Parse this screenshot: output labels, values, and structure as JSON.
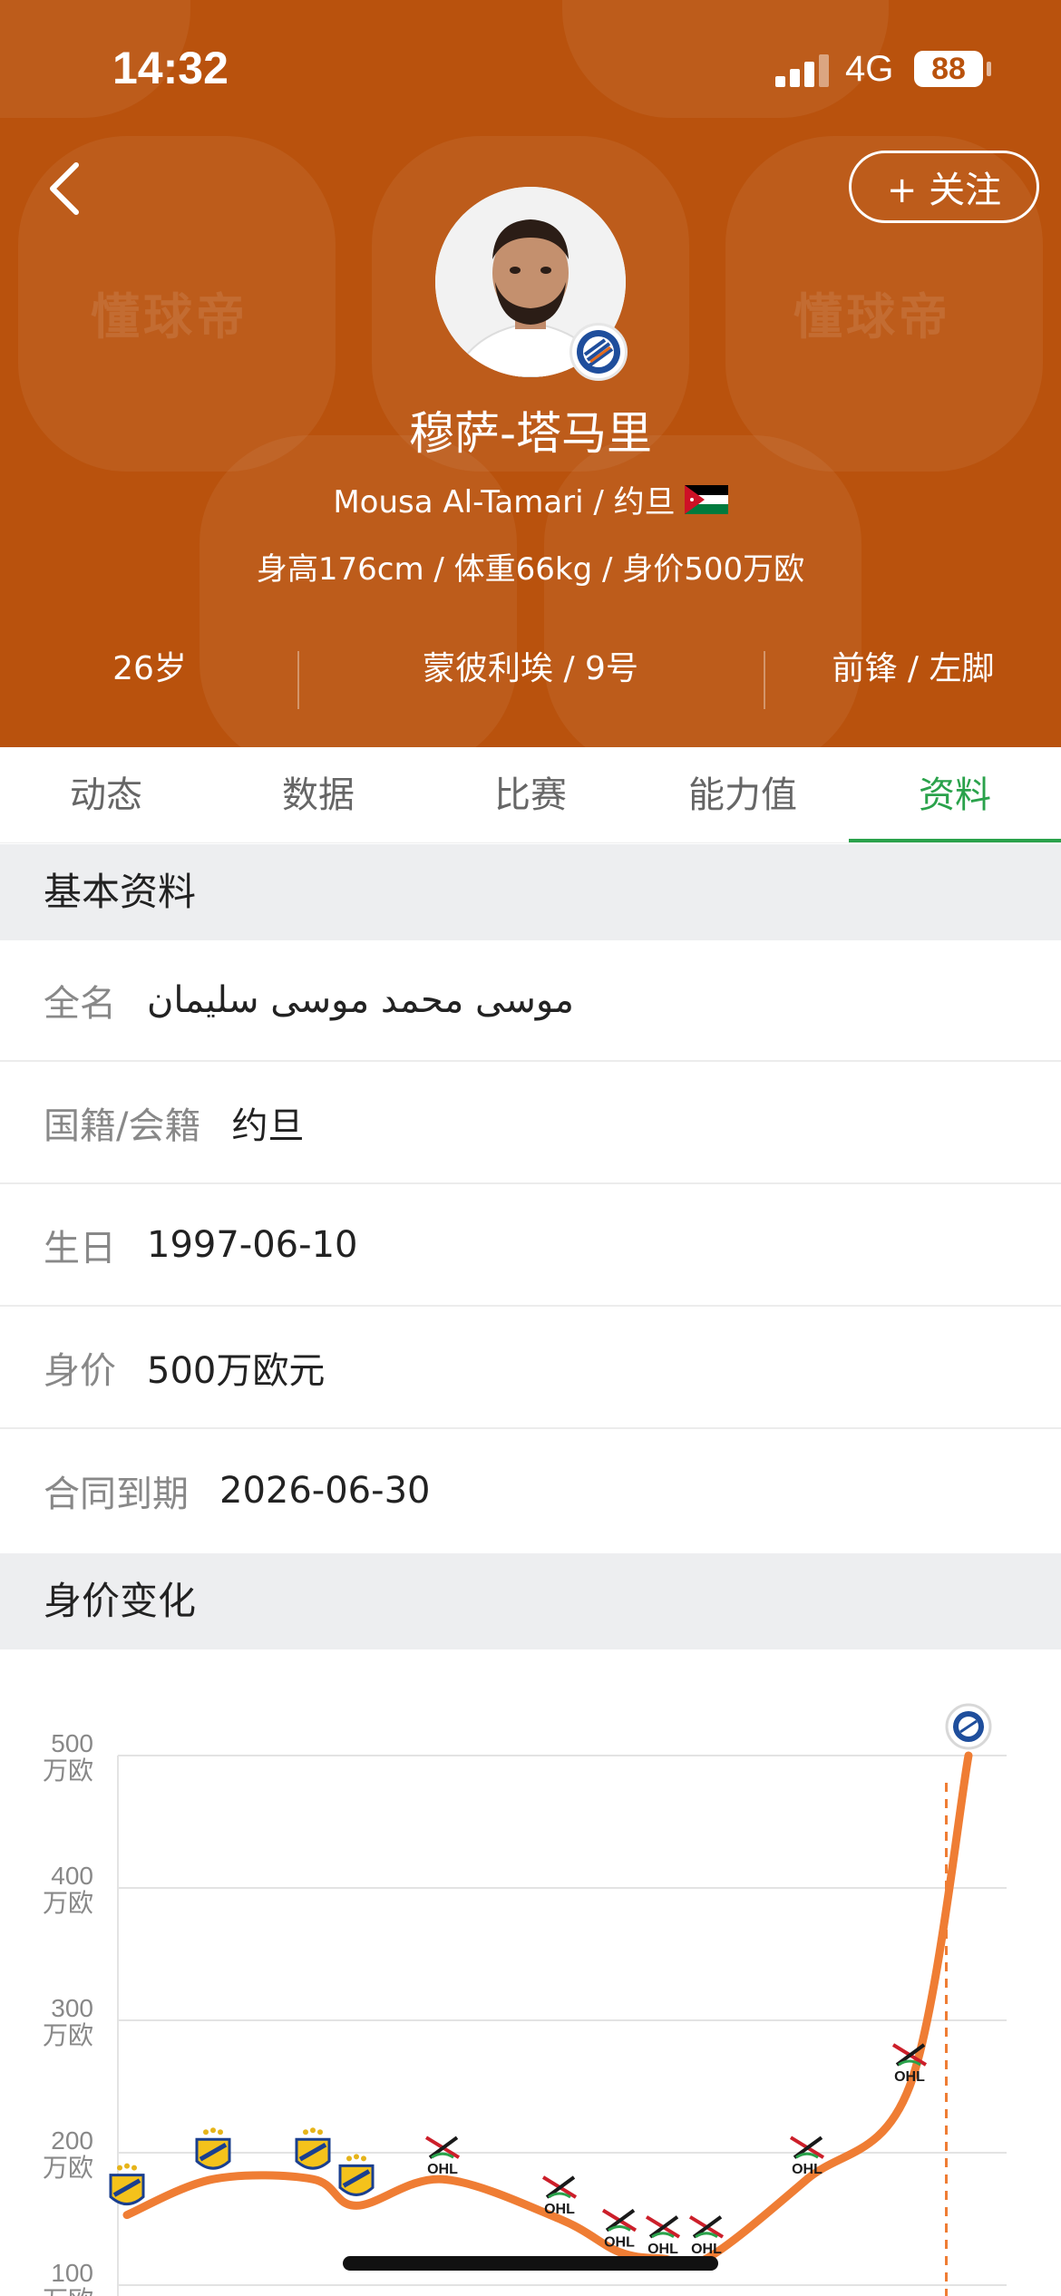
{
  "status_bar": {
    "time": "14:32",
    "network": "4G",
    "battery": "88"
  },
  "header": {
    "follow_label": "+ 关注",
    "watermark": "懂球帝",
    "player_name": "穆萨-塔马里",
    "player_sub": "Mousa Al-Tamari / 约旦",
    "player_stats": "身高176cm / 体重66kg / 身价500万欧",
    "info": {
      "age": "26岁",
      "club": "蒙彼利埃 / 9号",
      "position": "前锋 / 左脚"
    }
  },
  "tabs": [
    {
      "label": "动态"
    },
    {
      "label": "数据"
    },
    {
      "label": "比赛"
    },
    {
      "label": "能力值"
    },
    {
      "label": "资料"
    }
  ],
  "basic_info": {
    "title": "基本资料",
    "rows": [
      {
        "label": "全名",
        "value": "موسى محمد موسى سليمان"
      },
      {
        "label": "国籍/会籍",
        "value": "约旦"
      },
      {
        "label": "生日",
        "value": "1997-06-10"
      },
      {
        "label": "身价",
        "value": "500万欧元"
      },
      {
        "label": "合同到期",
        "value": "2026-06-30"
      }
    ]
  },
  "value_history": {
    "title": "身价变化"
  },
  "colors": {
    "header_bg": "#b9520d",
    "accent": "#2aa24b",
    "line": "#ef7d34"
  },
  "chart_data": {
    "type": "line",
    "ylabel": "万欧",
    "ylim": [
      100,
      500
    ],
    "y_ticks": [
      {
        "value": 500,
        "label": "500",
        "unit": "万欧"
      },
      {
        "value": 400,
        "label": "400",
        "unit": "万欧"
      },
      {
        "value": 300,
        "label": "300",
        "unit": "万欧"
      },
      {
        "value": 200,
        "label": "200",
        "unit": "万欧"
      },
      {
        "value": 100,
        "label": "100",
        "unit": "万欧"
      }
    ],
    "points": [
      {
        "index": 0,
        "value": 153,
        "club": "APOEL"
      },
      {
        "index": 1,
        "value": 180,
        "club": "APOEL"
      },
      {
        "index": 2,
        "value": 180,
        "club": "APOEL"
      },
      {
        "index": 3,
        "value": 160,
        "club": "APOEL"
      },
      {
        "index": 4,
        "value": 180,
        "club": "OHL"
      },
      {
        "index": 5,
        "value": 150,
        "club": "OHL"
      },
      {
        "index": 6,
        "value": 125,
        "club": "OHL"
      },
      {
        "index": 7,
        "value": 120,
        "club": "OHL"
      },
      {
        "index": 8,
        "value": 120,
        "club": "OHL"
      },
      {
        "index": 9,
        "value": 180,
        "club": "OHL"
      },
      {
        "index": 10,
        "value": 250,
        "club": "OHL"
      },
      {
        "index": 11,
        "value": 500,
        "club": "Montpellier"
      }
    ],
    "current_marker_index": 10,
    "grid": true
  }
}
